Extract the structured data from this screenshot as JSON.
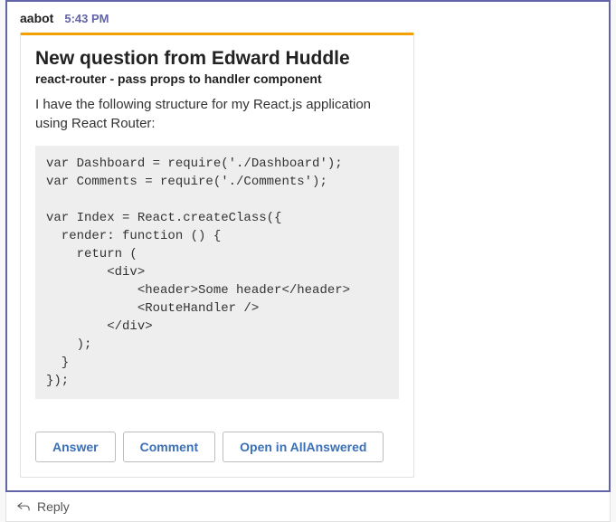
{
  "message": {
    "author": "aabot",
    "time": "5:43 PM"
  },
  "card": {
    "title": "New question from Edward Huddle",
    "subtitle": "react-router - pass props to handler component",
    "body": "I have the following structure for my React.js application using React Router:",
    "code": "var Dashboard = require('./Dashboard');\nvar Comments = require('./Comments');\n\nvar Index = React.createClass({\n  render: function () {\n    return (\n        <div>\n            <header>Some header</header>\n            <RouteHandler />\n        </div>\n    );\n  }\n});",
    "actions": {
      "answer": "Answer",
      "comment": "Comment",
      "open": "Open in AllAnswered"
    }
  },
  "reply": {
    "label": "Reply"
  }
}
